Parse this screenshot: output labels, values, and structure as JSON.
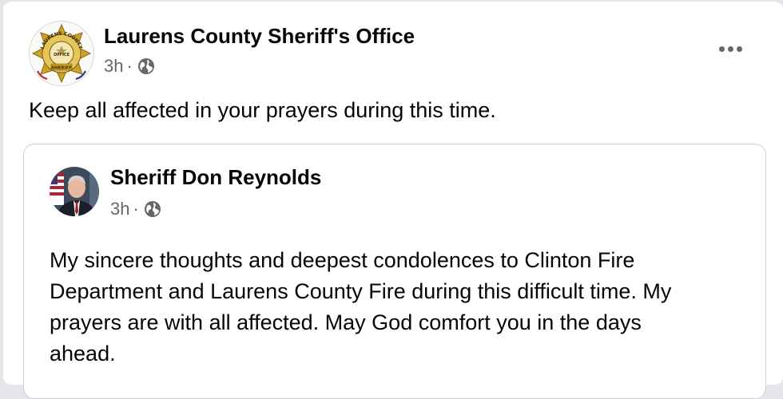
{
  "post": {
    "author": "Laurens County Sheriff's Office",
    "time": "3h",
    "separator": "·",
    "privacy_icon": "globe-icon",
    "menu_icon": "more-options-icon",
    "text": "Keep all affected in your prayers during this time.",
    "avatar": {
      "icon": "sheriff-badge-logo",
      "ring_text_top": "LAURENS COUNTY",
      "ring_text_bottom": "SHERIFF",
      "center_text": "OFFICE"
    }
  },
  "shared_post": {
    "author": "Sheriff Don Reynolds",
    "time": "3h",
    "separator": "·",
    "privacy_icon": "globe-icon",
    "avatar_icon": "profile-photo",
    "text_lines": [
      "My sincere thoughts and deepest condolences to Clinton Fire",
      "Department and Laurens County Fire during this difficult time. My",
      "prayers are with all affected. May God comfort you in the days",
      "ahead."
    ]
  },
  "colors": {
    "background": "#e4e6eb",
    "card": "#ffffff",
    "text_primary": "#050505",
    "text_secondary": "#65676b",
    "border": "#ced0d4",
    "badge_gold": "#c9a227"
  }
}
